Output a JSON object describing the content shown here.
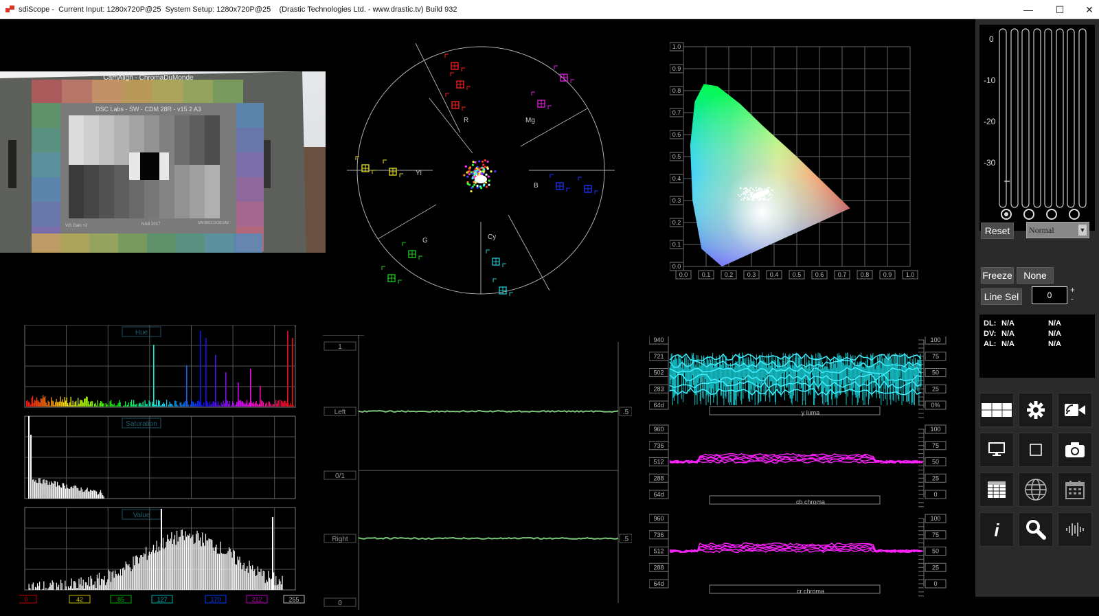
{
  "window": {
    "title": "sdiScope -  Current Input: 1280x720P@25  System Setup: 1280x720P@25    (Drastic Technologies Ltd. - www.drastic.tv) Build 932",
    "minimize": "—",
    "maximize": "☐",
    "close": "✕"
  },
  "preview": {
    "chart_top_text": "CamAlign - ChromaDuMonde",
    "chart_inner_title": "DSC Labs - SW - CDM 28R - v15.2 A3",
    "chart_small_left": "ViS Gain +2",
    "chart_small_mid": "NAB 2017",
    "chart_small_right": "SW-0601.10.03.2A3"
  },
  "vectorscope": {
    "labels": [
      "R",
      "Mg",
      "B",
      "Cy",
      "G",
      "Yl"
    ]
  },
  "cie": {
    "x_ticks": [
      "0.0",
      "0.1",
      "0.2",
      "0.3",
      "0.4",
      "0.5",
      "0.6",
      "0.7",
      "0.8",
      "0.9",
      "1.0"
    ],
    "y_ticks": [
      "0.0",
      "0.1",
      "0.2",
      "0.3",
      "0.4",
      "0.5",
      "0.6",
      "0.7",
      "0.8",
      "0.9",
      "1.0"
    ]
  },
  "hsv": {
    "hue_label": "Hue",
    "sat_label": "Saturation",
    "val_label": "Value",
    "bottom_ticks": [
      {
        "text": "0",
        "color": "#c00000"
      },
      {
        "text": "42",
        "color": "#c8c000"
      },
      {
        "text": "85",
        "color": "#00b000"
      },
      {
        "text": "127",
        "color": "#00b0b0"
      },
      {
        "text": "170",
        "color": "#0040ff"
      },
      {
        "text": "212",
        "color": "#c000c0"
      },
      {
        "text": "255",
        "color": "#c0c0c0"
      }
    ]
  },
  "audio": {
    "top": "1",
    "left": "Left",
    "mid": "0/1",
    "right": "Right",
    "bottom": "0",
    "left_scale": ".5",
    "right_scale": ".5"
  },
  "waveforms": {
    "luma": {
      "label": "y luma",
      "left": [
        "940",
        "721",
        "502",
        "283",
        "64d"
      ],
      "right": [
        "100",
        "75",
        "50",
        "25",
        "0%"
      ]
    },
    "cb": {
      "label": "cb chroma",
      "left": [
        "960",
        "736",
        "512",
        "288",
        "64d"
      ],
      "right": [
        "100",
        "75",
        "50",
        "25",
        "0"
      ]
    },
    "cr": {
      "label": "cr chroma",
      "left": [
        "960",
        "736",
        "512",
        "288",
        "64d"
      ],
      "right": [
        "100",
        "75",
        "50",
        "25",
        "0"
      ]
    }
  },
  "meters": {
    "scale": [
      "0",
      "-10",
      "-20",
      "-30"
    ]
  },
  "controls": {
    "reset": "Reset",
    "mode_select": "Normal",
    "freeze": "Freeze",
    "none": "None",
    "line_sel": "Line Sel",
    "line_value": "0",
    "plus": "+",
    "minus": "-"
  },
  "status": {
    "rows": [
      {
        "key": "DL:",
        "v1": "N/A",
        "v2": "N/A"
      },
      {
        "key": "DV:",
        "v1": "N/A",
        "v2": "N/A"
      },
      {
        "key": "AL:",
        "v1": "N/A",
        "v2": "N/A"
      }
    ]
  },
  "toolbar_icons": [
    "layout-grid-icon",
    "gear-icon",
    "record-icon",
    "monitor-icon",
    "square-icon",
    "camera-icon",
    "table-icon",
    "globe-icon",
    "calendar-icon",
    "info-icon",
    "search-icon",
    "audio-waveform-icon"
  ]
}
